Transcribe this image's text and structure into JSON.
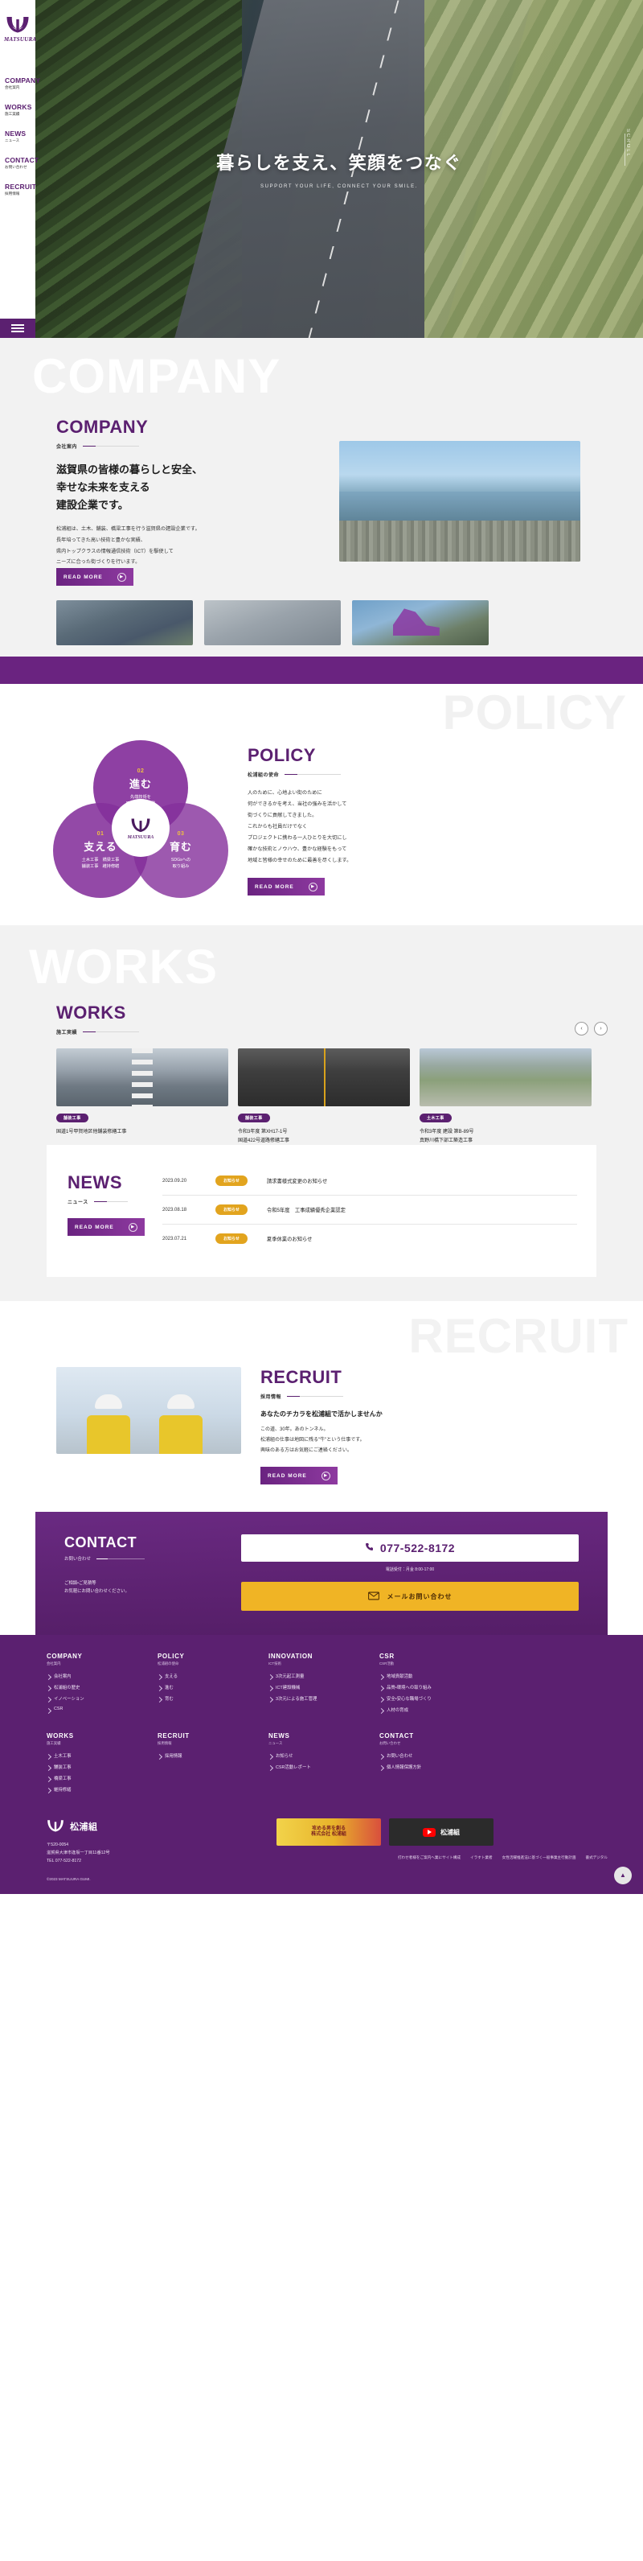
{
  "brand": {
    "name": "松浦組",
    "wordmark": "MATSUURA"
  },
  "sidebar": {
    "items": [
      {
        "en": "COMPANY",
        "jp": "会社案内"
      },
      {
        "en": "WORKS",
        "jp": "施工実績"
      },
      {
        "en": "NEWS",
        "jp": "ニュース"
      },
      {
        "en": "CONTACT",
        "jp": "お問い合わせ"
      },
      {
        "en": "RECRUIT",
        "jp": "採用情報"
      }
    ],
    "menu_icon": "hamburger-icon"
  },
  "hero": {
    "title": "暮らしを支え、笑顔をつなぐ",
    "subtitle": "SUPPORT YOUR LIFE, CONNECT YOUR SMILE.",
    "scroll_label": "SCROLL"
  },
  "company": {
    "ghost": "COMPANY",
    "en": "COMPANY",
    "jp": "会社案内",
    "lead": "滋賀県の皆様の暮らしと安全、\n幸せな未来を支える\n建設企業です。",
    "body": "松浦組は、土木、舗装、橋梁工事を行う滋賀県の建設企業です。\n長年培ってきた高い技術と豊かな実績、\n県内トップクラスの情報通信技術（ICT）を駆使して\nニーズに合った街づくりを行います。",
    "read_more": "READ MORE"
  },
  "policy": {
    "ghost": "POLICY",
    "en": "POLICY",
    "jp": "松浦組の使命",
    "body": "人のために、心地よい街のために\n何ができるかを考え、当社の強みを活かして\n街づくりに貢献してきました。\nこれからも社員だけでなく\nプロジェクトに携わる一人ひとりを大切にし\n確かな技術とノウハウ、豊かな経験をもって\n地域と皆様の幸せのために最善を尽くします。",
    "read_more": "READ MORE",
    "circles": [
      {
        "num": "01",
        "title": "支える",
        "desc": "土木工事　橋梁工事\n舗装工事　維持修繕"
      },
      {
        "num": "02",
        "title": "進む",
        "desc": "先端技術を\n取り入れた開発"
      },
      {
        "num": "03",
        "title": "育む",
        "desc": "SDGsへの\n取り組み"
      }
    ]
  },
  "works": {
    "ghost": "WORKS",
    "en": "WORKS",
    "jp": "施工実績",
    "prev_icon": "chevron-left-icon",
    "next_icon": "chevron-right-icon",
    "cards": [
      {
        "tag": "舗装工事",
        "title": "国道1号甲賀地区他舗装修繕工事"
      },
      {
        "tag": "舗装工事",
        "title": "令和3年度 第XH17-1号\n国道422号道路修繕工事"
      },
      {
        "tag": "土木工事",
        "title": "令和3年度 建設 第B-89号\n真野川橋下部工築造工事"
      }
    ]
  },
  "news": {
    "en": "NEWS",
    "jp": "ニュース",
    "read_more": "READ MORE",
    "items": [
      {
        "date": "2023.09.20",
        "badge": "お知らせ",
        "title": "請求書様式変更のお知らせ"
      },
      {
        "date": "2023.08.18",
        "badge": "お知らせ",
        "title": "令和5年度　工事成績優秀企業認定"
      },
      {
        "date": "2023.07.21",
        "badge": "お知らせ",
        "title": "夏季休業のお知らせ"
      }
    ]
  },
  "recruit": {
    "ghost": "RECRUIT",
    "en": "RECRUIT",
    "jp": "採用情報",
    "lead": "あなたのチカラを松浦組で活かしませんか",
    "body": "この道、30年。あのトンネル。\n松浦組の仕事は地図に残る\"牛\"という仕事です。\n興味のある方はお気軽にご連絡ください。",
    "read_more": "READ MORE"
  },
  "contact": {
    "en": "CONTACT",
    "jp": "お問い合わせ",
    "note": "ご相談・ご見積等\nお気軽にお問い合わせください。",
    "phone_icon": "phone-icon",
    "phone": "077-522-8172",
    "hours": "電話受付：月金 8:00-17:00",
    "mail_icon": "mail-icon",
    "mail_label": "メールお問い合わせ"
  },
  "footer": {
    "columns": [
      {
        "head": "COMPANY",
        "head_jp": "会社案内",
        "links": [
          "会社案内",
          "松浦組の歴史",
          "イノベーション",
          "CSR"
        ]
      },
      {
        "head": "POLICY",
        "head_jp": "松浦組の使命",
        "links": [
          "支える",
          "進む",
          "育む"
        ]
      },
      {
        "head": "INNOVATION",
        "head_jp": "ICT技術",
        "links": [
          "3次元起工測量",
          "ICT建設機械",
          "3次元による施工管理"
        ]
      },
      {
        "head": "CSR",
        "head_jp": "CSR活動",
        "links": [
          "地域貢献活動",
          "品質・環境への取り組み",
          "安全・安心な職場づくり",
          "人材の育成"
        ]
      }
    ],
    "columns2": [
      {
        "head": "WORKS",
        "head_jp": "施工実績",
        "links": [
          "土木工事",
          "舗装工事",
          "橋梁工事",
          "維持修繕"
        ]
      },
      {
        "head": "RECRUIT",
        "head_jp": "採用情報",
        "links": [
          "採用情報"
        ]
      },
      {
        "head": "NEWS",
        "head_jp": "ニュース",
        "links": [
          "お知らせ",
          "CSR活動レポート"
        ]
      },
      {
        "head": "CONTACT",
        "head_jp": "お問い合わせ",
        "links": [
          "お問い合わせ",
          "個人情報保護方針"
        ]
      }
    ],
    "company_name": "松浦組",
    "address": "〒520-0054\n滋賀県大津市逢坂一丁目11番12号\nTEL 077-522-8172",
    "banner1": "攻める男を創る\n株式会社 松浦組",
    "banner2_icon": "youtube-icon",
    "banner2": "松浦組",
    "links": [
      "打わせ者様をご案内へ業にサイト構成",
      "イラすト業者",
      "女性活躍推進法に基づく一般事業主行動計画",
      "書式デジタル"
    ],
    "copyright": "©2023 MATSUURA GUMI.",
    "totop_icon": "chevron-up-icon"
  }
}
